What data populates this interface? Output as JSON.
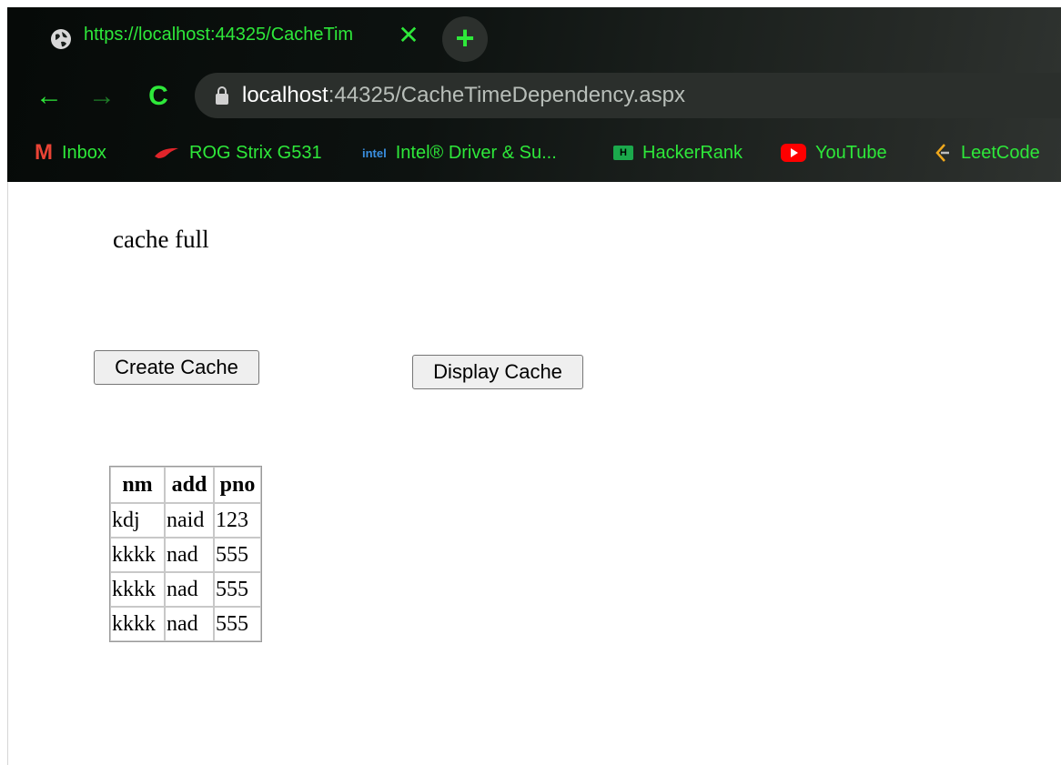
{
  "browser": {
    "tab": {
      "title": "https://localhost:44325/CacheTim",
      "close": "✕"
    },
    "new_tab": "+",
    "nav": {
      "back": "←",
      "forward": "→",
      "reload": "C"
    },
    "address": {
      "host": "localhost",
      "rest": ":44325/CacheTimeDependency.aspx"
    },
    "bookmarks": [
      {
        "label": "Inbox",
        "icon": "gmail-icon",
        "glyph": "M"
      },
      {
        "label": "ROG Strix G531",
        "icon": "rog-icon"
      },
      {
        "label": "Intel® Driver & Su...",
        "icon": "intel-icon",
        "glyph": "intel"
      },
      {
        "label": "HackerRank",
        "icon": "hackerrank-icon",
        "glyph": "H"
      },
      {
        "label": "YouTube",
        "icon": "youtube-icon"
      },
      {
        "label": "LeetCode",
        "icon": "leetcode-icon"
      }
    ],
    "colors": {
      "accent": "#2ee83a",
      "chrome_bg": "#0d1210"
    }
  },
  "page": {
    "status": "cache full",
    "buttons": {
      "create": "Create Cache",
      "display": "Display Cache"
    },
    "table": {
      "headers": [
        "nm",
        "add",
        "pno"
      ],
      "rows": [
        [
          "kdj",
          "naid",
          "123"
        ],
        [
          "kkkk",
          "nad",
          "555"
        ],
        [
          "kkkk",
          "nad",
          "555"
        ],
        [
          "kkkk",
          "nad",
          "555"
        ]
      ]
    }
  }
}
